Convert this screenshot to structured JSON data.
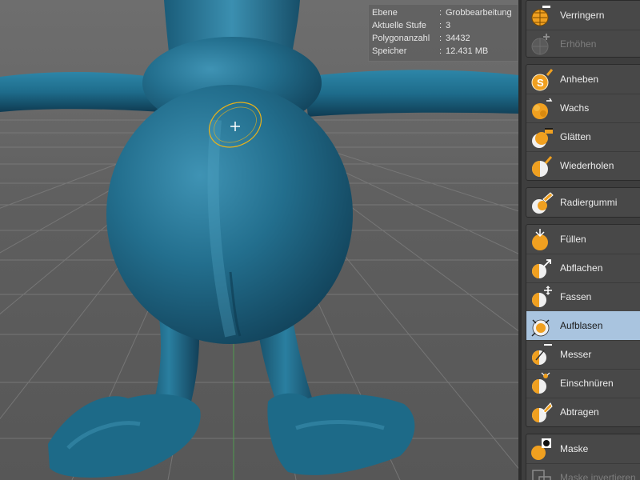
{
  "hud": {
    "rows": [
      {
        "key": "Ebene",
        "value": "Grobbearbeitung"
      },
      {
        "key": "Aktuelle Stufe",
        "value": "3"
      },
      {
        "key": "Polygonanzahl",
        "value": "34432"
      },
      {
        "key": "Speicher",
        "value": "12.431 MB"
      }
    ],
    "separator": ":"
  },
  "tools": {
    "verringern": "Verringern",
    "erhoehen": "Erhöhen",
    "anheben": "Anheben",
    "wachs": "Wachs",
    "glaetten": "Glätten",
    "wiederholen": "Wiederholen",
    "radiergummi": "Radiergummi",
    "fuellen": "Füllen",
    "abflachen": "Abflachen",
    "fassen": "Fassen",
    "aufblasen": "Aufblasen",
    "messer": "Messer",
    "einschnueren": "Einschnüren",
    "abtragen": "Abtragen",
    "maske": "Maske",
    "maske_invertieren": "Maske invertieren"
  },
  "active_tool": "Aufblasen",
  "colors": {
    "model": "#1f6f8f",
    "brush_ring": "#e8b21a",
    "tool_orange": "#f0a020",
    "active_highlight": "#a9c4df"
  }
}
